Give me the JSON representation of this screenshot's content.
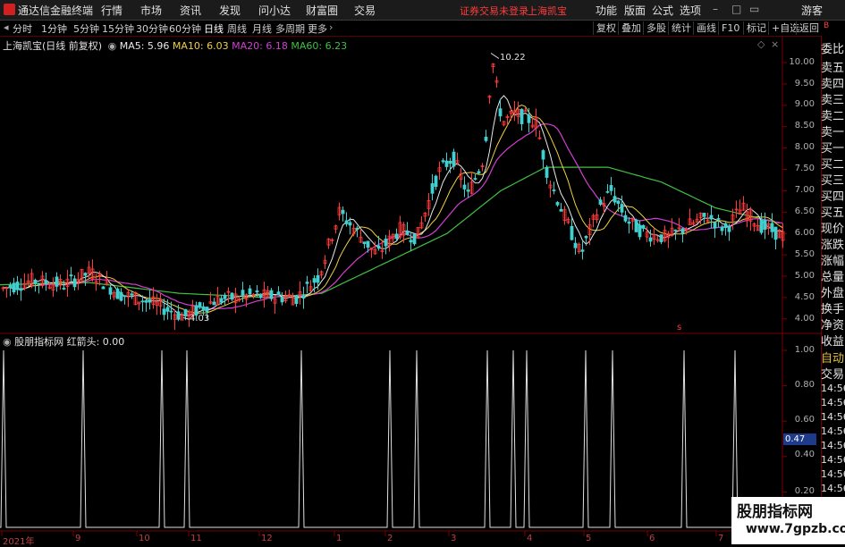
{
  "app": {
    "title": "通达信金融终端"
  },
  "menu": [
    "行情",
    "市场",
    "资讯",
    "发现",
    "问小达",
    "财富圈",
    "交易"
  ],
  "warning": "证券交易未登录",
  "stock_name_top": "上海凯宝",
  "right_menu": [
    "功能",
    "版面",
    "公式",
    "选项"
  ],
  "guest": "游客",
  "periods": [
    "分时",
    "1分钟",
    "5分钟",
    "15分钟",
    "30分钟",
    "60分钟",
    "日线",
    "周线",
    "月线",
    "多周期",
    "更多"
  ],
  "active_period": "日线",
  "tools": [
    "复权",
    "叠加",
    "多股",
    "统计",
    "画线",
    "F10",
    "标记",
    "+自选",
    "返回"
  ],
  "chart_header": {
    "title": "上海凯宝(日线 前复权)",
    "ma5": "MA5: 5.96",
    "ma10": "MA10: 6.03",
    "ma20": "MA20: 6.18",
    "ma60": "MA60: 6.23"
  },
  "colors": {
    "ma5": "#e8e8e8",
    "ma10": "#f0d040",
    "ma20": "#d040d0",
    "ma60": "#40c040",
    "up": "#ff3b3b",
    "down": "#40d0d0",
    "grid": "#7a0000",
    "indicator": "#e0e0e0"
  },
  "annotations": {
    "high": "10.22",
    "low": "4.03"
  },
  "y_axis_main": [
    "10.00",
    "9.50",
    "9.00",
    "8.50",
    "8.00",
    "7.50",
    "7.00",
    "6.50",
    "6.00",
    "5.50",
    "5.00",
    "4.50",
    "4.00"
  ],
  "indicator_header": {
    "name": "股朋指标网",
    "label": "红箭头: 0.00"
  },
  "y_axis_ind": [
    "1.00",
    "0.80",
    "0.60",
    "0.40",
    "0.20"
  ],
  "current_ind_value": "0.47",
  "x_axis": [
    "2021年",
    "9",
    "10",
    "11",
    "12",
    "1",
    "2",
    "3",
    "4",
    "5",
    "6",
    "7"
  ],
  "side_panel": [
    "委比",
    "卖五",
    "卖四",
    "卖三",
    "卖二",
    "卖一",
    "买一",
    "买二",
    "买三",
    "买四",
    "买五",
    "现价",
    "涨跌",
    "涨幅",
    "总量",
    "外盘",
    "换手",
    "净资",
    "收益"
  ],
  "side_panel_lower": [
    "自动",
    "交易",
    "14:56",
    "14:56",
    "14:56",
    "14:56",
    "14:56",
    "14:56",
    "14:56",
    "14:56",
    "14:56",
    "14:56"
  ],
  "marker": "s",
  "watermark": {
    "line1": "股朋指标网",
    "line2": "www.7gpzb.com"
  },
  "chart_data": {
    "type": "candlestick",
    "title": "上海凯宝(日线 前复权)",
    "y_range_main": [
      3.8,
      10.4
    ],
    "high_label": 10.22,
    "low_label": 4.03,
    "ma_last": {
      "MA5": 5.96,
      "MA10": 6.03,
      "MA20": 6.18,
      "MA60": 6.23
    },
    "price_anchors": [
      {
        "x": 0,
        "price": 4.7
      },
      {
        "x": 35,
        "price": 4.9
      },
      {
        "x": 70,
        "price": 4.8
      },
      {
        "x": 100,
        "price": 5.1
      },
      {
        "x": 130,
        "price": 4.6
      },
      {
        "x": 165,
        "price": 4.4
      },
      {
        "x": 205,
        "price": 4.05
      },
      {
        "x": 240,
        "price": 4.45
      },
      {
        "x": 280,
        "price": 4.55
      },
      {
        "x": 330,
        "price": 4.5
      },
      {
        "x": 355,
        "price": 5.0
      },
      {
        "x": 378,
        "price": 6.5
      },
      {
        "x": 395,
        "price": 6.1
      },
      {
        "x": 420,
        "price": 5.5
      },
      {
        "x": 445,
        "price": 6.1
      },
      {
        "x": 465,
        "price": 5.9
      },
      {
        "x": 488,
        "price": 7.4
      },
      {
        "x": 505,
        "price": 7.8
      },
      {
        "x": 522,
        "price": 6.9
      },
      {
        "x": 540,
        "price": 7.8
      },
      {
        "x": 549,
        "price": 10.1
      },
      {
        "x": 560,
        "price": 8.6
      },
      {
        "x": 575,
        "price": 8.8
      },
      {
        "x": 598,
        "price": 8.6
      },
      {
        "x": 612,
        "price": 7.3
      },
      {
        "x": 628,
        "price": 6.5
      },
      {
        "x": 648,
        "price": 5.5
      },
      {
        "x": 668,
        "price": 6.6
      },
      {
        "x": 682,
        "price": 7.0
      },
      {
        "x": 700,
        "price": 6.3
      },
      {
        "x": 720,
        "price": 6.0
      },
      {
        "x": 745,
        "price": 5.9
      },
      {
        "x": 770,
        "price": 6.2
      },
      {
        "x": 790,
        "price": 6.4
      },
      {
        "x": 810,
        "price": 6.1
      },
      {
        "x": 828,
        "price": 6.6
      },
      {
        "x": 848,
        "price": 6.2
      },
      {
        "x": 874,
        "price": 5.95
      }
    ],
    "ma60_anchors": [
      {
        "x": 0,
        "price": 4.8
      },
      {
        "x": 100,
        "price": 4.85
      },
      {
        "x": 200,
        "price": 4.6
      },
      {
        "x": 300,
        "price": 4.5
      },
      {
        "x": 360,
        "price": 4.6
      },
      {
        "x": 420,
        "price": 5.2
      },
      {
        "x": 500,
        "price": 6.0
      },
      {
        "x": 560,
        "price": 7.0
      },
      {
        "x": 610,
        "price": 7.55
      },
      {
        "x": 680,
        "price": 7.55
      },
      {
        "x": 740,
        "price": 7.2
      },
      {
        "x": 800,
        "price": 6.6
      },
      {
        "x": 874,
        "price": 6.23
      }
    ],
    "indicator": {
      "name": "红箭头",
      "y_range": [
        0,
        1.0
      ],
      "spike_positions": [
        4,
        93,
        181,
        209,
        337,
        436,
        466,
        545,
        574,
        589,
        655,
        685,
        765,
        822
      ]
    }
  }
}
